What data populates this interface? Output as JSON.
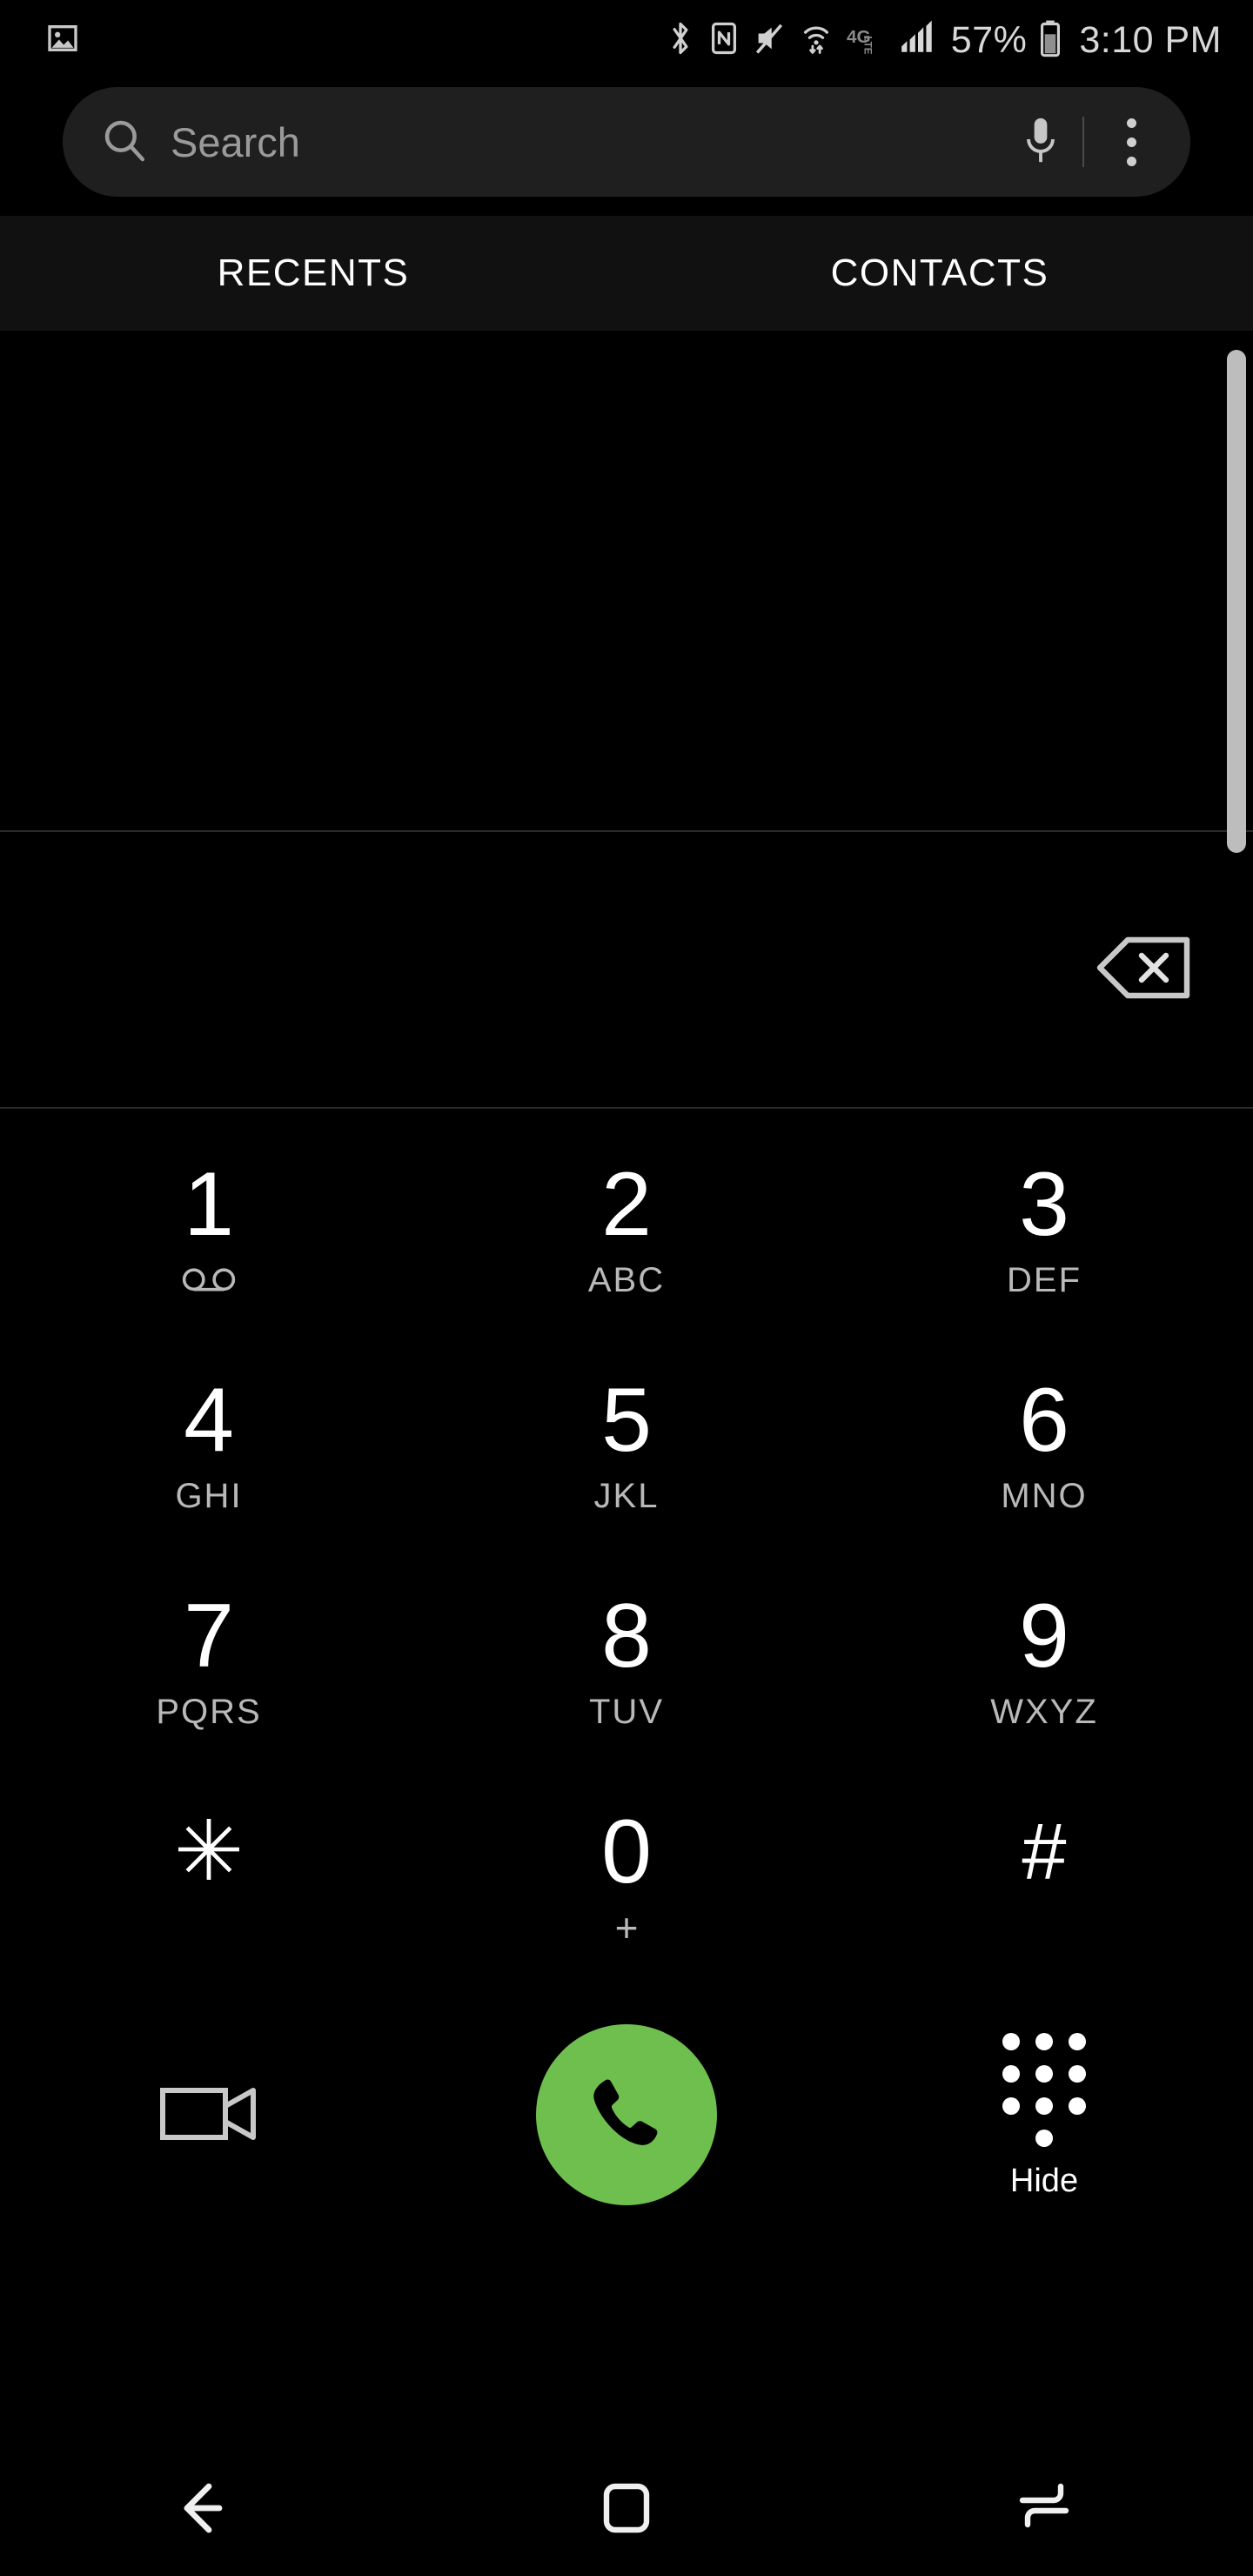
{
  "status_bar": {
    "left_icons": [
      {
        "name": "photo-icon",
        "label": "Photo"
      }
    ],
    "right_icons": [
      {
        "name": "bluetooth-icon",
        "label": "Bluetooth"
      },
      {
        "name": "nfc-icon",
        "label": "NFC"
      },
      {
        "name": "mute-icon",
        "label": "Sound muted"
      },
      {
        "name": "wifi-transfer-icon",
        "label": "Wi-Fi"
      },
      {
        "name": "lte-4g-icon",
        "label": "4G LTE"
      },
      {
        "name": "signal-bars-icon",
        "label": "Cellular signal"
      }
    ],
    "battery_percent": "57%",
    "battery_icon": "battery-icon",
    "time": "3:10 PM"
  },
  "search": {
    "placeholder": "Search",
    "search_icon": "search-icon",
    "mic_icon": "microphone-icon",
    "overflow_icon": "overflow-menu-icon"
  },
  "tabs": [
    {
      "label": "RECENTS",
      "name": "tab-recents",
      "selected": false
    },
    {
      "label": "CONTACTS",
      "name": "tab-contacts",
      "selected": false
    }
  ],
  "dial_display": {
    "number": "",
    "backspace_icon": "backspace-icon"
  },
  "keypad": {
    "keys": [
      {
        "digit": "1",
        "sub": "",
        "sub_icon": "voicemail-icon",
        "name": "key-1"
      },
      {
        "digit": "2",
        "sub": "ABC",
        "sub_icon": "",
        "name": "key-2"
      },
      {
        "digit": "3",
        "sub": "DEF",
        "sub_icon": "",
        "name": "key-3"
      },
      {
        "digit": "4",
        "sub": "GHI",
        "sub_icon": "",
        "name": "key-4"
      },
      {
        "digit": "5",
        "sub": "JKL",
        "sub_icon": "",
        "name": "key-5"
      },
      {
        "digit": "6",
        "sub": "MNO",
        "sub_icon": "",
        "name": "key-6"
      },
      {
        "digit": "7",
        "sub": "PQRS",
        "sub_icon": "",
        "name": "key-7"
      },
      {
        "digit": "8",
        "sub": "TUV",
        "sub_icon": "",
        "name": "key-8"
      },
      {
        "digit": "9",
        "sub": "WXYZ",
        "sub_icon": "",
        "name": "key-9"
      },
      {
        "digit": "✳",
        "sub": "",
        "sub_icon": "",
        "name": "key-star"
      },
      {
        "digit": "0",
        "sub": "+",
        "sub_icon": "",
        "name": "key-0"
      },
      {
        "digit": "#",
        "sub": "",
        "sub_icon": "",
        "name": "key-pound"
      }
    ]
  },
  "actions": {
    "video_call_icon": "video-call-icon",
    "call_icon": "phone-call-icon",
    "call_button_color": "#6fbf4f",
    "hide_label": "Hide",
    "hide_icon": "keypad-dots-icon"
  },
  "nav_bar": {
    "back_icon": "back-arrow-icon",
    "home_icon": "home-square-icon",
    "recents_icon": "recents-icon"
  },
  "colors": {
    "background": "#000000",
    "tab_bar": "#111111",
    "search_field": "#1f1f1f",
    "accent_green": "#6fbf4f",
    "divider": "#2a2a2a",
    "secondary_text": "#b9b9b9"
  }
}
